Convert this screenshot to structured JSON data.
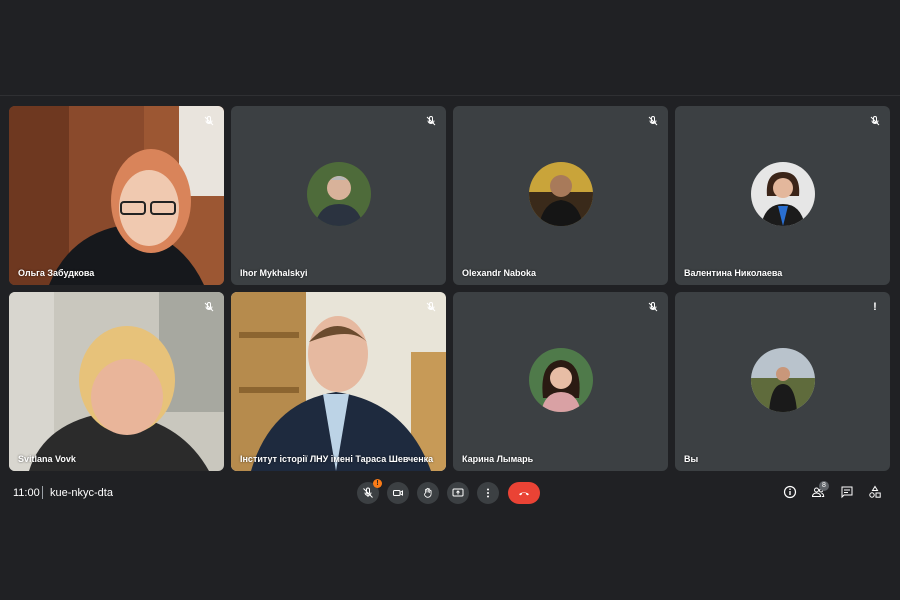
{
  "participants": [
    {
      "name": "Ольга Забудкова",
      "muted": true
    },
    {
      "name": "Ihor Mykhalskyi",
      "muted": true
    },
    {
      "name": "Olexandr Naboka",
      "muted": true
    },
    {
      "name": "Валентина Николаева",
      "muted": true
    },
    {
      "name": "Svitlana Vovk",
      "muted": true
    },
    {
      "name": "Інститут історії ЛНУ імені Тараса Шевченка",
      "muted": true
    },
    {
      "name": "Карина Лымарь",
      "muted": true
    },
    {
      "name": "Вы",
      "muted": false,
      "status": "!"
    }
  ],
  "toolbar": {
    "time": "11:00",
    "meeting_code": "kue-nkyc-dta",
    "mic_alert": "!",
    "people_count": "8"
  },
  "icons": {
    "mute": "mic-off-icon",
    "camera": "camera-icon",
    "hand": "raise-hand-icon",
    "present": "present-screen-icon",
    "more": "more-vert-icon",
    "end": "hang-up-icon",
    "info": "info-icon",
    "people": "people-icon",
    "chat": "chat-icon",
    "activities": "activities-icon"
  },
  "colors": {
    "background": "#202124",
    "tile": "#3c4043",
    "end_call": "#ea4335",
    "alert": "#fa7b17"
  }
}
